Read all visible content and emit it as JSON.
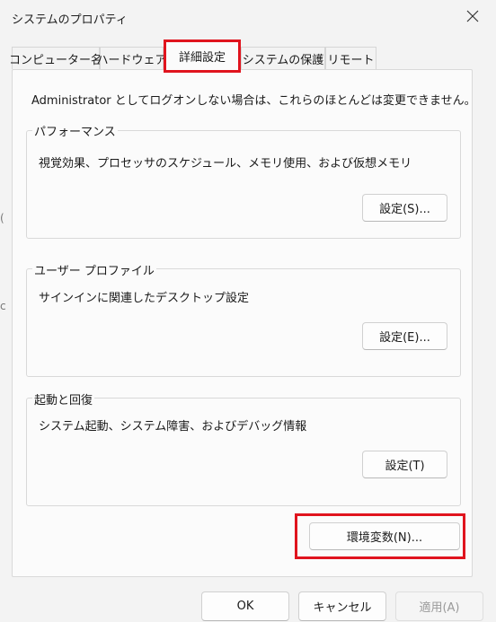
{
  "window": {
    "title": "システムのプロパティ"
  },
  "tabs": [
    {
      "label": "コンピューター名"
    },
    {
      "label": "ハードウェア"
    },
    {
      "label": "詳細設定"
    },
    {
      "label": "システムの保護"
    },
    {
      "label": "リモート"
    }
  ],
  "intro": "Administrator としてログオンしない場合は、これらのほとんどは変更できません。",
  "groups": {
    "performance": {
      "title": "パフォーマンス",
      "description": "視覚効果、プロセッサのスケジュール、メモリ使用、および仮想メモリ",
      "button": "設定(S)..."
    },
    "profile": {
      "title": "ユーザー プロファイル",
      "description": "サインインに関連したデスクトップ設定",
      "button": "設定(E)..."
    },
    "startup": {
      "title": "起動と回復",
      "description": "システム起動、システム障害、およびデバッグ情報",
      "button": "設定(T)"
    }
  },
  "env_button": "環境変数(N)...",
  "footer": {
    "ok": "OK",
    "cancel": "キャンセル",
    "apply": "適用(A)"
  },
  "colors": {
    "highlight": "#e0141e",
    "background": "#f3f3f3"
  }
}
